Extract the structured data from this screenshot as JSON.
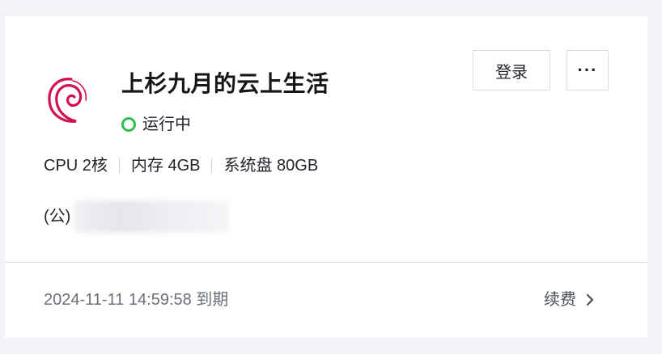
{
  "instance": {
    "name": "上杉九月的云上生活",
    "status": "运行中",
    "status_color": "#2fbf4f",
    "os_icon": "debian-logo"
  },
  "actions": {
    "login_label": "登录",
    "more_label": "···"
  },
  "specs": {
    "cpu": "CPU 2核",
    "memory": "内存 4GB",
    "disk": "系统盘 80GB"
  },
  "network": {
    "public_ip_prefix": "(公)"
  },
  "footer": {
    "expire_text": "2024-11-11 14:59:58 到期",
    "renew_label": "续费"
  }
}
